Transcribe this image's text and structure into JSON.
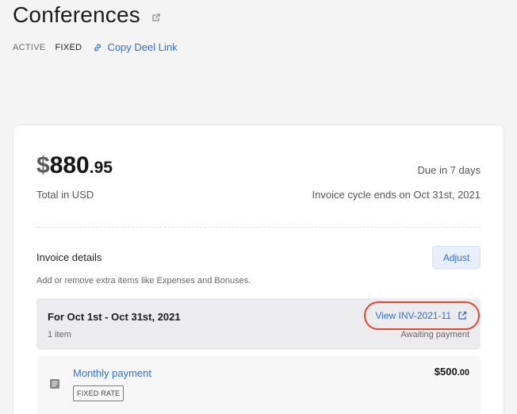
{
  "header": {
    "title": "Conferences",
    "status_badge": "ACTIVE",
    "type_badge": "FIXED",
    "copy_link_label": "Copy Deel Link",
    "edit_icon": "edit-external-icon",
    "link_icon": "link-icon"
  },
  "summary": {
    "amount_currency": "$",
    "amount_whole": "880",
    "amount_cents": ".95",
    "total_label": "Total in USD",
    "due_text": "Due in 7 days",
    "cycle_text": "Invoice cycle ends on Oct 31st, 2021"
  },
  "invoice_details": {
    "title": "Invoice details",
    "adjust_label": "Adjust",
    "subtitle": "Add or remove extra items like Expenses and Bonuses."
  },
  "period": {
    "title": "For Oct 1st - Oct 31st, 2021",
    "item_count": "1 item",
    "view_invoice_label": "View INV-2021-11",
    "status": "Awaiting payment",
    "external_icon": "external-link-icon"
  },
  "line_item": {
    "icon": "document-icon",
    "name": "Monthly payment",
    "rate_tag": "FIXED RATE",
    "amount_whole": "$500",
    "amount_cents": ".00"
  },
  "colors": {
    "accent_blue": "#2f6fd4",
    "highlight_red": "#e8452f",
    "background": "#f4f4f5"
  }
}
